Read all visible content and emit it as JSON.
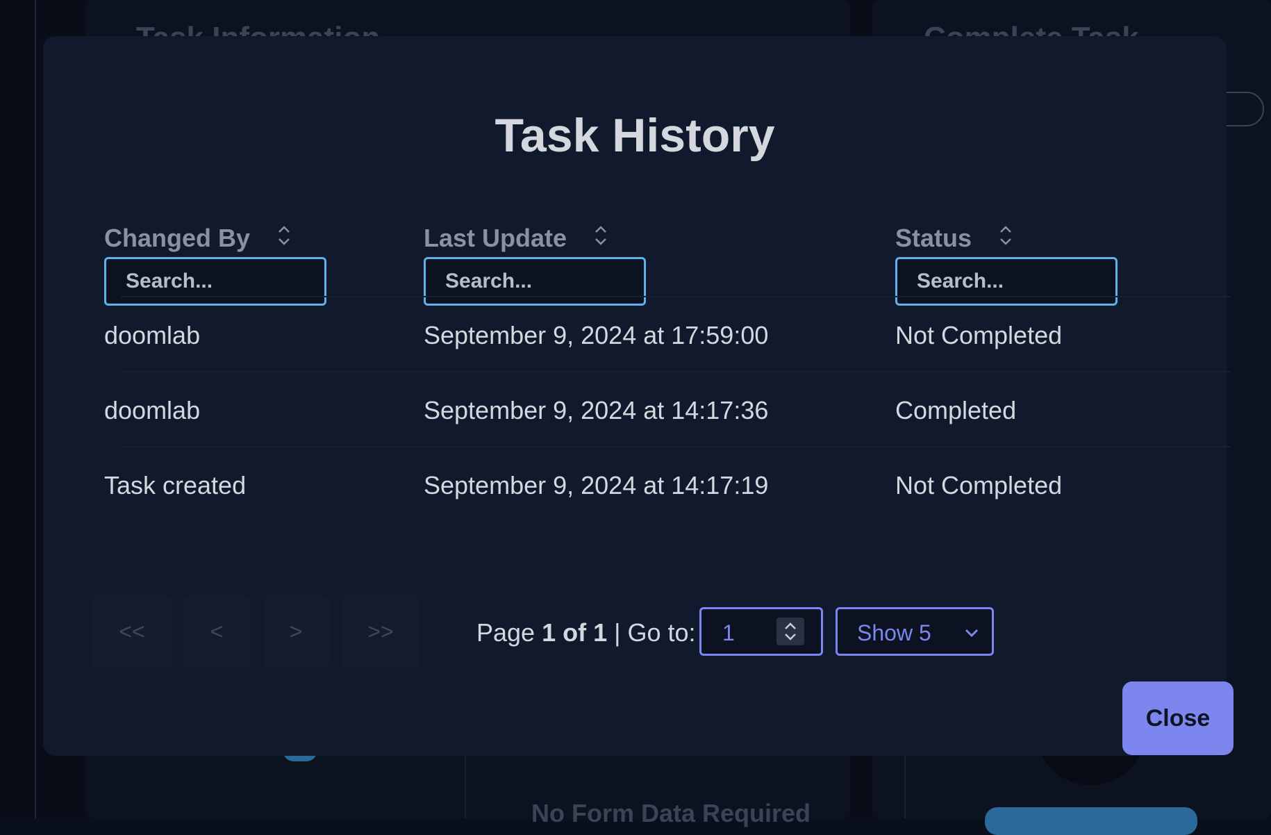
{
  "background": {
    "left_heading": "Task Information",
    "right_heading": "Complete Task",
    "bottom_text": "No Form Data Required"
  },
  "modal": {
    "title": "Task History",
    "columns": [
      {
        "label": "Changed By",
        "search_placeholder": "Search..."
      },
      {
        "label": "Last Update",
        "search_placeholder": "Search..."
      },
      {
        "label": "Status",
        "search_placeholder": "Search..."
      }
    ],
    "rows": [
      {
        "changed_by": "doomlab",
        "last_update": "September 9, 2024 at 17:59:00",
        "status": "Not Completed"
      },
      {
        "changed_by": "doomlab",
        "last_update": "September 9, 2024 at 14:17:36",
        "status": "Completed"
      },
      {
        "changed_by": "Task created",
        "last_update": "September 9, 2024 at 14:17:19",
        "status": "Not Completed"
      }
    ],
    "pagination": {
      "first_label": "<<",
      "prev_label": "<",
      "next_label": ">",
      "last_label": ">>",
      "page_prefix": "Page",
      "page_current_of_total": "1 of 1",
      "goto_label": "| Go to:",
      "goto_value": "1",
      "page_size_label": "Show 5"
    },
    "close_label": "Close"
  },
  "colors": {
    "accent": "#7c86ee",
    "search_border": "#5fb1ec",
    "modal_bg": "#111a2c"
  }
}
